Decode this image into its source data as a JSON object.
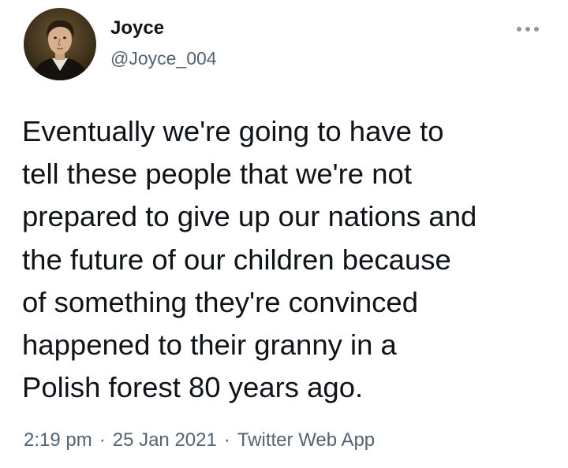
{
  "author": {
    "display_name": "Joyce",
    "handle": "@Joyce_004"
  },
  "menu": {
    "icon": "more-horizontal-icon"
  },
  "tweet": {
    "lines": [
      "Eventually we're going to have to",
      "tell these people that we're not",
      "prepared to give up our nations and",
      "the future of our children because",
      "of something they're convinced",
      "happened to their granny in a",
      "Polish forest 80 years ago."
    ]
  },
  "meta": {
    "time": "2:19 pm",
    "separator": "·",
    "date": "25 Jan 2021",
    "source": "Twitter Web App"
  },
  "colors": {
    "text": "#0f1419",
    "secondary": "#536471",
    "background": "#ffffff"
  }
}
